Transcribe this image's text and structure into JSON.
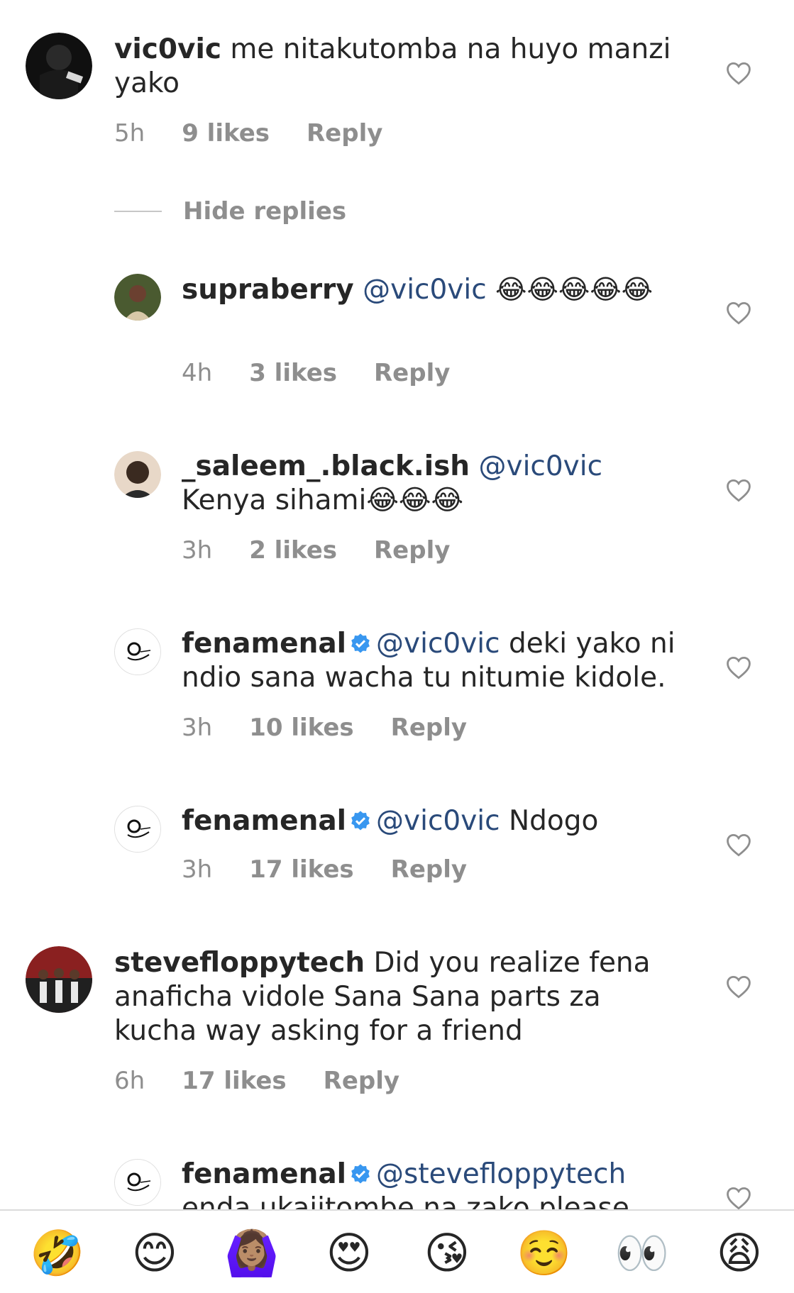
{
  "comments": [
    {
      "username": "vic0vic",
      "text": "me nitakutomba na huyo manzi yako",
      "time": "5h",
      "likes": "9 likes",
      "reply": "Reply"
    }
  ],
  "hide_replies": "Hide replies",
  "replies": [
    {
      "username": "supraberry",
      "mention": "@vic0vic",
      "text": "😂😂😂😂😂",
      "time": "4h",
      "likes": "3 likes",
      "reply": "Reply"
    },
    {
      "username": "_saleem_.black.ish",
      "mention": "@vic0vic",
      "text": " Kenya sihami😂😂😂",
      "time": "3h",
      "likes": "2 likes",
      "reply": "Reply"
    },
    {
      "username": "fenamenal",
      "mention": "@vic0vic",
      "text": " deki yako ni ndio sana wacha tu nitumie kidole.",
      "time": "3h",
      "likes": "10 likes",
      "reply": "Reply"
    },
    {
      "username": "fenamenal",
      "mention": "@vic0vic",
      "text": " Ndogo",
      "time": "3h",
      "likes": "17 likes",
      "reply": "Reply"
    }
  ],
  "comment2": {
    "username": "stevefloppytech",
    "text": "Did you realize fena anaficha vidole Sana Sana parts za kucha  way asking for a friend",
    "time": "6h",
    "likes": "17 likes",
    "reply": "Reply"
  },
  "comment3": {
    "username": "fenamenal",
    "mention": "@stevefloppytech",
    "text": "enda ukajitombe na zako please"
  },
  "emoji_bar": [
    "🤣",
    "😊",
    "🙆🏽‍♀️",
    "😍",
    "😘",
    "☺️",
    "👀",
    "😩"
  ],
  "colors": {
    "text": "#262626",
    "meta": "#8e8e8e",
    "mention": "#2a4a7a",
    "verified": "#3897f0",
    "divider": "#dbdbdb"
  }
}
